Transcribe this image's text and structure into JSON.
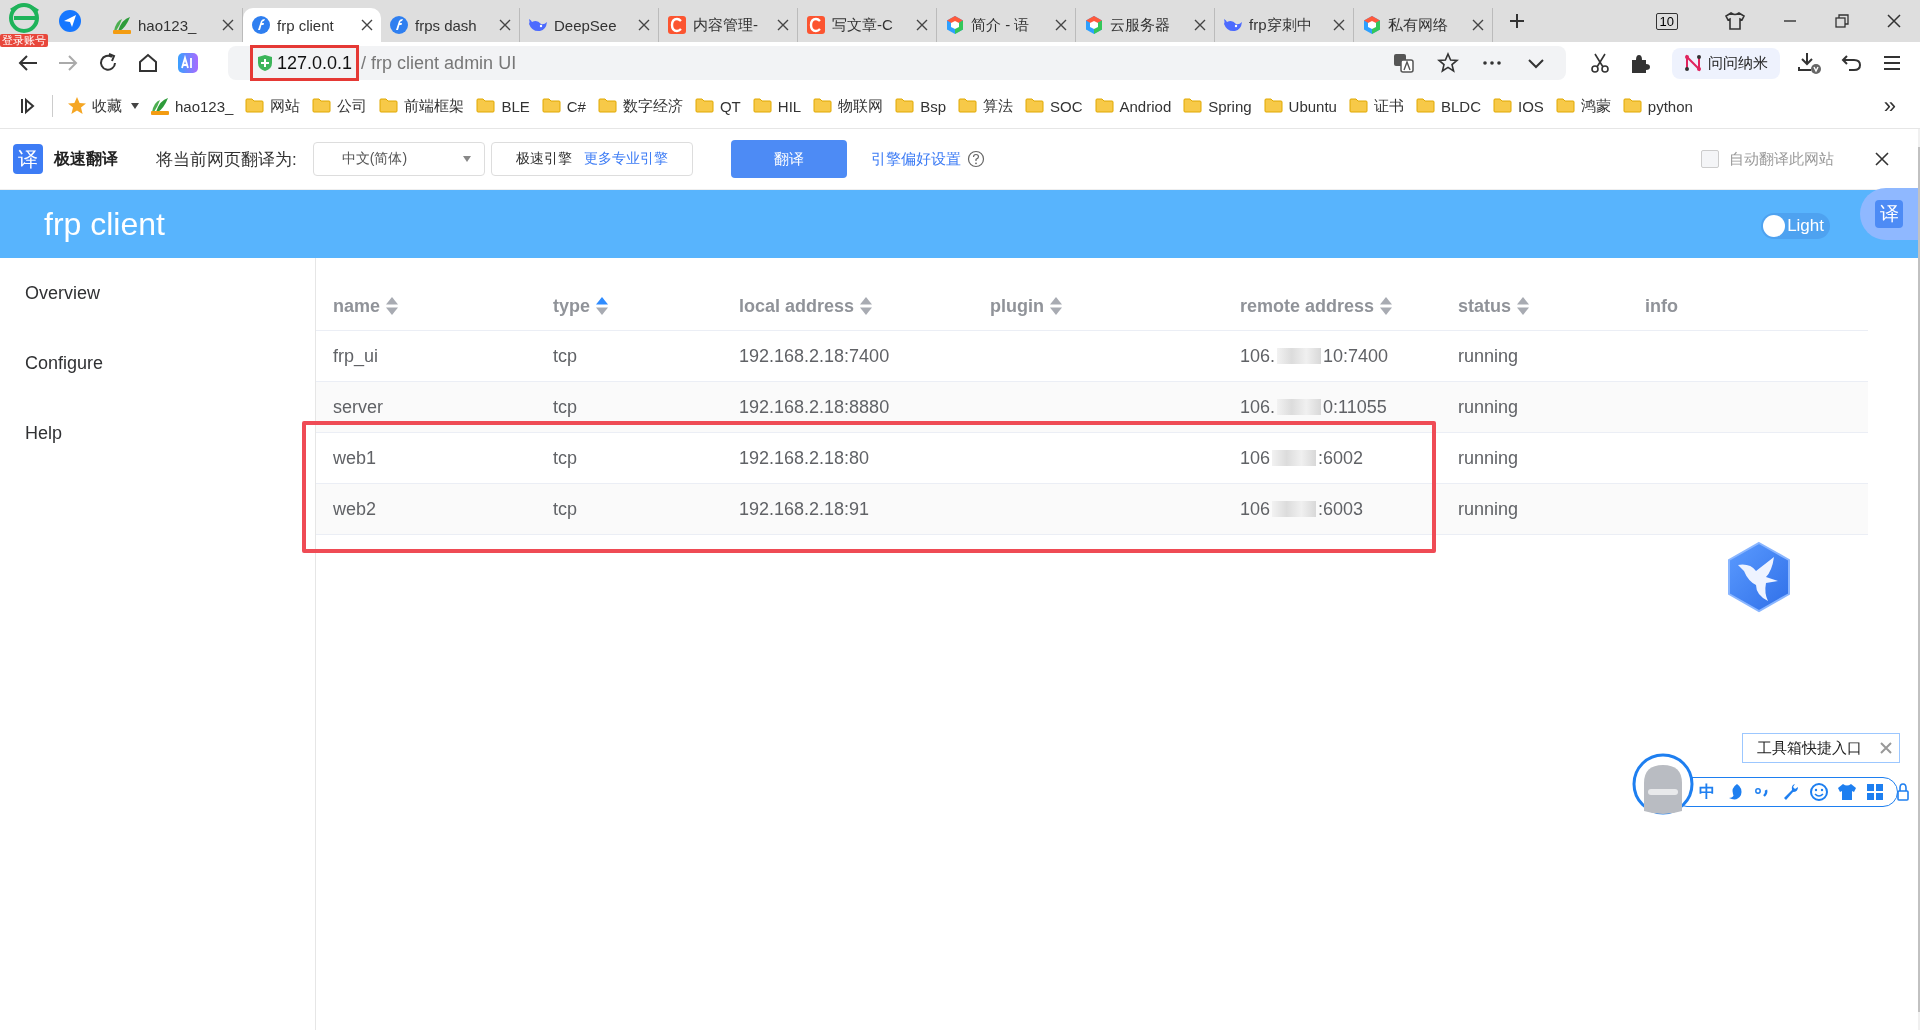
{
  "browser": {
    "login_badge": "登录账号",
    "tabs": [
      {
        "title": "hao123_",
        "kind": "leaf",
        "selected": false
      },
      {
        "title": "frp client",
        "kind": "frp",
        "selected": true
      },
      {
        "title": "frps dash",
        "kind": "frp",
        "selected": false
      },
      {
        "title": "DeepSee",
        "kind": "whale",
        "selected": false
      },
      {
        "title": "内容管理-",
        "kind": "csdn",
        "selected": false
      },
      {
        "title": "写文章-C",
        "kind": "csdn",
        "selected": false
      },
      {
        "title": "简介 - 语",
        "kind": "cube",
        "selected": false
      },
      {
        "title": "云服务器",
        "kind": "cube",
        "selected": false
      },
      {
        "title": "frp穿刺中",
        "kind": "whale",
        "selected": false
      },
      {
        "title": "私有网络",
        "kind": "cube",
        "selected": false
      }
    ],
    "tab_count": "10",
    "address": {
      "host": "127.0.0.1",
      "host_highlighted": true,
      "path": "/ frp client admin UI"
    },
    "assistant": "问问纳米",
    "bookmarks": [
      {
        "label": "收藏",
        "kind": "star"
      },
      {
        "label": "hao123_",
        "kind": "leaf"
      },
      {
        "label": "网站",
        "kind": "folder"
      },
      {
        "label": "公司",
        "kind": "folder"
      },
      {
        "label": "前端框架",
        "kind": "folder"
      },
      {
        "label": "BLE",
        "kind": "folder"
      },
      {
        "label": "C#",
        "kind": "folder"
      },
      {
        "label": "数字经济",
        "kind": "folder"
      },
      {
        "label": "QT",
        "kind": "folder"
      },
      {
        "label": "HIL",
        "kind": "folder"
      },
      {
        "label": "物联网",
        "kind": "folder"
      },
      {
        "label": "Bsp",
        "kind": "folder"
      },
      {
        "label": "算法",
        "kind": "folder"
      },
      {
        "label": "SOC",
        "kind": "folder"
      },
      {
        "label": "Andriod",
        "kind": "folder"
      },
      {
        "label": "Spring",
        "kind": "folder"
      },
      {
        "label": "Ubuntu",
        "kind": "folder"
      },
      {
        "label": "证书",
        "kind": "folder"
      },
      {
        "label": "BLDC",
        "kind": "folder"
      },
      {
        "label": "IOS",
        "kind": "folder"
      },
      {
        "label": "鸿蒙",
        "kind": "folder"
      },
      {
        "label": "python",
        "kind": "folder"
      }
    ],
    "overflow": "»"
  },
  "translate_bar": {
    "logo": "译",
    "title": "极速翻译",
    "prompt": "将当前网页翻译为:",
    "language": "中文(简体)",
    "engine": "极速引擎",
    "more_engines": "更多专业引擎",
    "button": "翻译",
    "settings": "引擎偏好设置",
    "auto_translate": {
      "label": "自动翻译此网站",
      "checked": false
    }
  },
  "app": {
    "title": "frp client",
    "theme": {
      "label": "Light",
      "on": false
    },
    "float_translate": "译",
    "sidebar": {
      "items": [
        {
          "label": "Overview",
          "selected": false
        },
        {
          "label": "Configure",
          "selected": false
        },
        {
          "label": "Help",
          "selected": false
        }
      ]
    },
    "table": {
      "columns": [
        {
          "label": "name",
          "sortable": true,
          "sorted_ascending": false
        },
        {
          "label": "type",
          "sortable": true,
          "sorted_ascending": true
        },
        {
          "label": "local address",
          "sortable": true,
          "sorted_ascending": false
        },
        {
          "label": "plugin",
          "sortable": true,
          "sorted_ascending": false
        },
        {
          "label": "remote address",
          "sortable": true,
          "sorted_ascending": false
        },
        {
          "label": "status",
          "sortable": true,
          "sorted_ascending": false
        },
        {
          "label": "info",
          "sortable": false
        }
      ],
      "rows": [
        {
          "name": "frp_ui",
          "type": "tcp",
          "local_address": "192.168.2.18:7400",
          "remote_address": {
            "before": "106.",
            "after": "10:7400"
          },
          "status": "running",
          "highlighted": false
        },
        {
          "name": "server",
          "type": "tcp",
          "local_address": "192.168.2.18:8880",
          "remote_address": {
            "before": "106.",
            "after": "0:11055"
          },
          "status": "running",
          "highlighted": false
        },
        {
          "name": "web1",
          "type": "tcp",
          "local_address": "192.168.2.18:80",
          "remote_address": {
            "before": "106",
            "after": ":6002"
          },
          "status": "running",
          "highlighted": true
        },
        {
          "name": "web2",
          "type": "tcp",
          "local_address": "192.168.2.18:91",
          "remote_address": {
            "before": "106",
            "after": ":6003"
          },
          "status": "running",
          "highlighted": true
        }
      ]
    }
  },
  "toolbox": {
    "tooltip": "工具箱快捷入口",
    "input_mode": "中"
  }
}
